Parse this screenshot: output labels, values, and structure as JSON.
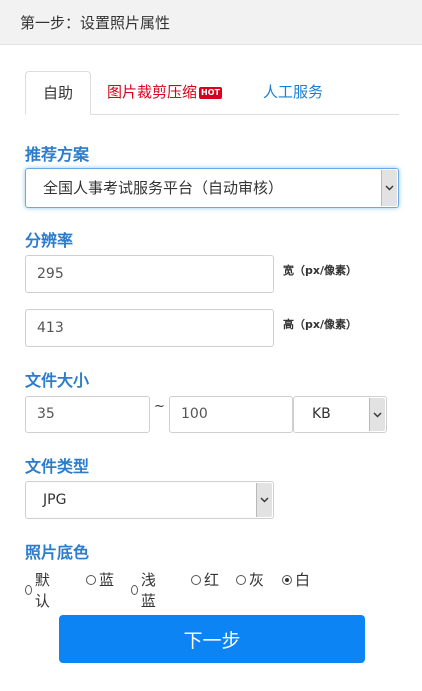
{
  "header": {
    "title": "第一步：设置照片属性"
  },
  "tabs": [
    {
      "label": "自助"
    },
    {
      "label": "图片裁剪压缩",
      "badge": "HOT"
    },
    {
      "label": "人工服务"
    }
  ],
  "scheme": {
    "label": "推荐方案",
    "selected": "全国人事考试服务平台（自动审核）"
  },
  "resolution": {
    "label": "分辨率",
    "width_value": "295",
    "width_unit": "宽（px/像素）",
    "height_value": "413",
    "height_unit": "高（px/像素）"
  },
  "filesize": {
    "label": "文件大小",
    "min": "35",
    "separator": "~",
    "max": "100",
    "unit_selected": "KB"
  },
  "filetype": {
    "label": "文件类型",
    "selected": "JPG"
  },
  "bgcolor": {
    "label": "照片底色",
    "options": [
      "默认",
      "蓝",
      "浅蓝",
      "红",
      "灰",
      "白"
    ],
    "selected_index": 5
  },
  "next_button": {
    "label": "下一步"
  }
}
